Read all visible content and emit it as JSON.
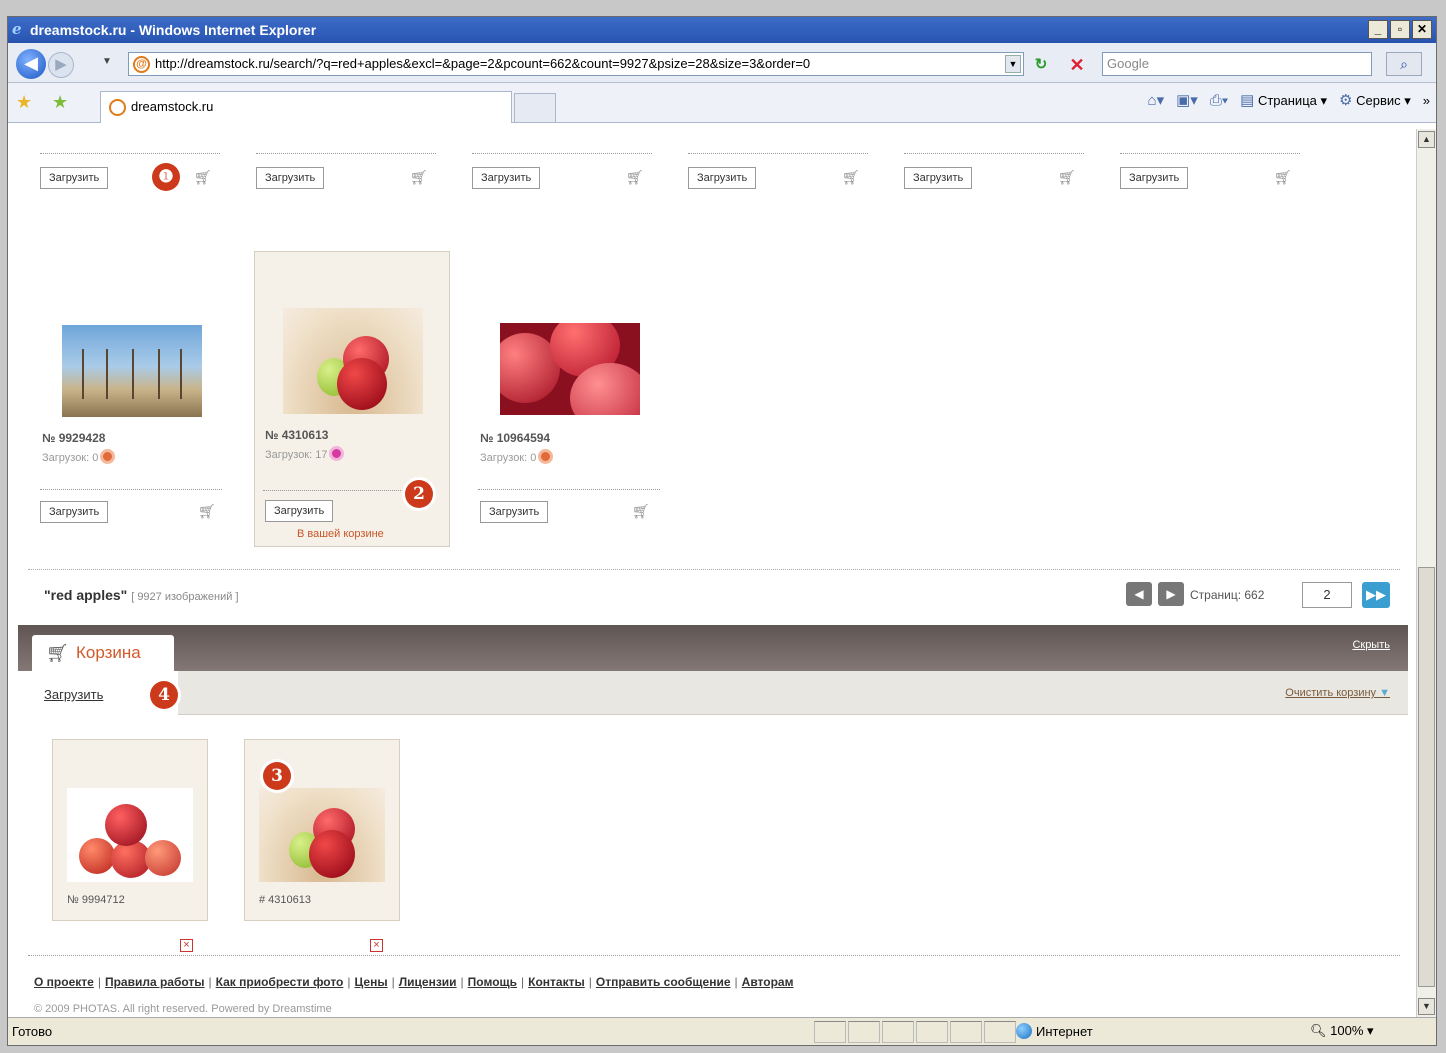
{
  "browser": {
    "title": "dreamstock.ru - Windows Internet Explorer",
    "url": "http://dreamstock.ru/search/?q=red+apples&excl=&page=2&pcount=662&count=9927&psize=28&size=3&order=0",
    "search_placeholder": "Google",
    "tab_title": "dreamstock.ru",
    "page_menu": "Страница",
    "tools_menu": "Сервис",
    "status_text": "Готово",
    "zone": "Интернет",
    "zoom": "100%"
  },
  "icons": [
    "ie-icon",
    "back-icon",
    "forward-icon",
    "refresh-icon",
    "stop-icon",
    "search-icon",
    "favorites-star-icon",
    "add-favorite-icon",
    "home-icon",
    "rss-icon",
    "print-icon",
    "page-icon",
    "tools-gear-icon",
    "cart-icon",
    "remove-icon",
    "globe-icon"
  ],
  "top_row": {
    "button_label": "Загрузить",
    "count": 6
  },
  "results": [
    {
      "id": "№ 9929428",
      "downloads": "Загрузок: 0",
      "button": "Загрузить",
      "in_cart": ""
    },
    {
      "id": "№ 4310613",
      "downloads": "Загрузок: 17",
      "button": "Загрузить",
      "in_cart": "В вашей корзине"
    },
    {
      "id": "№ 10964594",
      "downloads": "Загрузок: 0",
      "button": "Загрузить",
      "in_cart": ""
    }
  ],
  "resultbar": {
    "query": "\"red apples\"",
    "count": "[ 9927 изображений ]",
    "pages_label": "Страниц: 662",
    "current_page": "2"
  },
  "cart": {
    "title": "Корзина",
    "hide": "Скрыть",
    "download": "Загрузить",
    "clear": "Очистить корзину",
    "items": [
      {
        "id": "№ 9994712"
      },
      {
        "id": "# 4310613"
      }
    ]
  },
  "badges": [
    "❶",
    "2",
    "3",
    "4"
  ],
  "footer": {
    "links": [
      "О проекте",
      "Правила работы",
      "Как приобрести фото",
      "Цены",
      "Лицензии",
      "Помощь",
      "Контакты",
      "Отправить сообщение",
      "Авторам"
    ],
    "copyright": "© 2009 PHOTAS. All right reserved. Powered by Dreamstime"
  }
}
